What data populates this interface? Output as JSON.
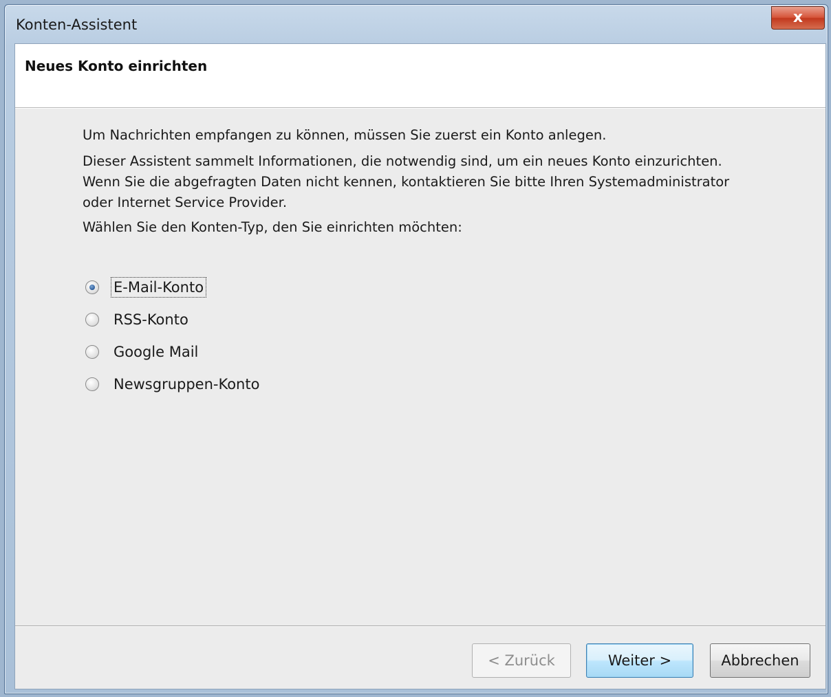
{
  "window": {
    "title": "Konten-Assistent",
    "close_icon": "close-icon",
    "close_glyph": "x"
  },
  "header": {
    "title": "Neues Konto einrichten"
  },
  "content": {
    "intro": "Um Nachrichten empfangen zu können, müssen Sie zuerst ein Konto anlegen.",
    "info_line1": "Dieser Assistent sammelt Informationen, die notwendig sind, um ein neues Konto einzurichten.",
    "info_line2": "Wenn Sie die abgefragten Daten nicht kennen, kontaktieren Sie bitte Ihren Systemadministrator",
    "info_line3": "oder Internet Service Provider.",
    "prompt": "Wählen Sie den Konten-Typ, den Sie einrichten möchten:"
  },
  "account_types": [
    {
      "label": "E-Mail-Konto",
      "selected": true
    },
    {
      "label": "RSS-Konto",
      "selected": false
    },
    {
      "label": "Google Mail",
      "selected": false
    },
    {
      "label": "Newsgruppen-Konto",
      "selected": false
    }
  ],
  "buttons": {
    "back": "< Zurück",
    "next": "Weiter >",
    "cancel": "Abbrechen"
  },
  "colors": {
    "accent": "#3c7fb1",
    "close_red": "#c2391e"
  }
}
